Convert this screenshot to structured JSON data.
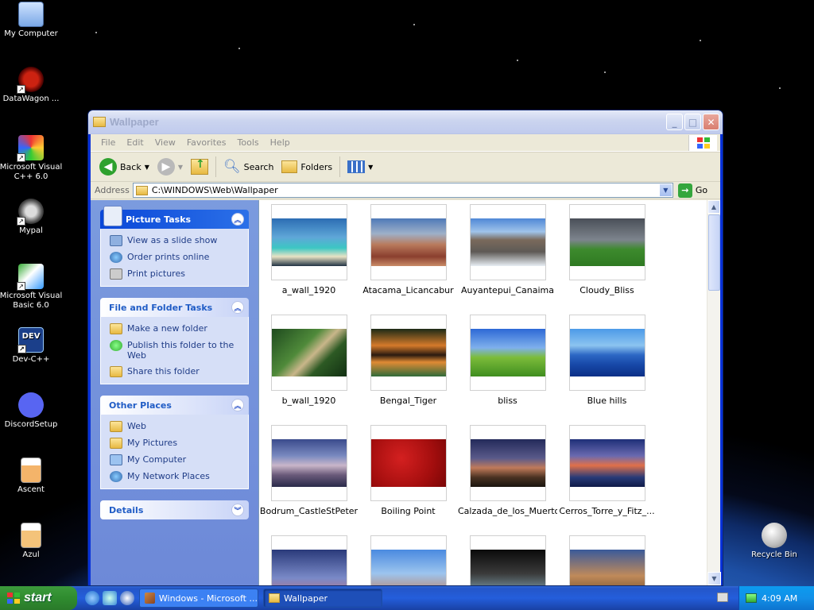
{
  "desktop": {
    "icons": [
      {
        "label": "My Computer",
        "icon": "my-computer-icon"
      },
      {
        "label": "DataWagon ...",
        "icon": "datawagon-icon"
      },
      {
        "label": "Microsoft Visual C++ 6.0",
        "icon": "visual-cpp-icon"
      },
      {
        "label": "Mypal",
        "icon": "mypal-icon"
      },
      {
        "label": "Microsoft Visual Basic 6.0",
        "icon": "visual-basic-icon"
      },
      {
        "label": "Dev-C++",
        "icon": "dev-cpp-icon",
        "badge": "DEV"
      },
      {
        "label": "DiscordSetup",
        "icon": "discord-icon"
      },
      {
        "label": "Ascent",
        "icon": "ascent-icon"
      },
      {
        "label": "Azul",
        "icon": "azul-icon"
      },
      {
        "label": "Recycle Bin",
        "icon": "recycle-bin-icon"
      }
    ]
  },
  "window": {
    "title": "Wallpaper",
    "menu": [
      "File",
      "Edit",
      "View",
      "Favorites",
      "Tools",
      "Help"
    ],
    "toolbar": {
      "back": "Back",
      "search": "Search",
      "folders": "Folders"
    },
    "address": {
      "label": "Address",
      "path": "C:\\WINDOWS\\Web\\Wallpaper",
      "go": "Go"
    },
    "tasks": {
      "picture": {
        "title": "Picture Tasks",
        "items": [
          "View as a slide show",
          "Order prints online",
          "Print pictures"
        ]
      },
      "file": {
        "title": "File and Folder Tasks",
        "items": [
          "Make a new folder",
          "Publish this folder to the Web",
          "Share this folder"
        ]
      },
      "other": {
        "title": "Other Places",
        "items": [
          "Web",
          "My Pictures",
          "My Computer",
          "My Network Places"
        ]
      },
      "details": {
        "title": "Details"
      }
    },
    "files": [
      "a_wall_1920",
      "Atacama_Licancabur",
      "Auyantepui_Canaima",
      "Cloudy_Bliss",
      "b_wall_1920",
      "Bengal_Tiger",
      "bliss",
      "Blue hills",
      "Bodrum_CastleStPeter",
      "Boiling Point",
      "Calzada_de_los_Muertos",
      "Cerros_Torre_y_Fitz_..."
    ]
  },
  "taskbar": {
    "start": "start",
    "tasks": [
      "Windows - Microsoft ...",
      "Wallpaper"
    ],
    "clock": "4:09 AM"
  },
  "colors": {
    "titlebar_inactive": "#cbd4ef",
    "taskpane": "#7b9bde",
    "taskbar": "#245edb",
    "start": "#2f8c2f"
  }
}
